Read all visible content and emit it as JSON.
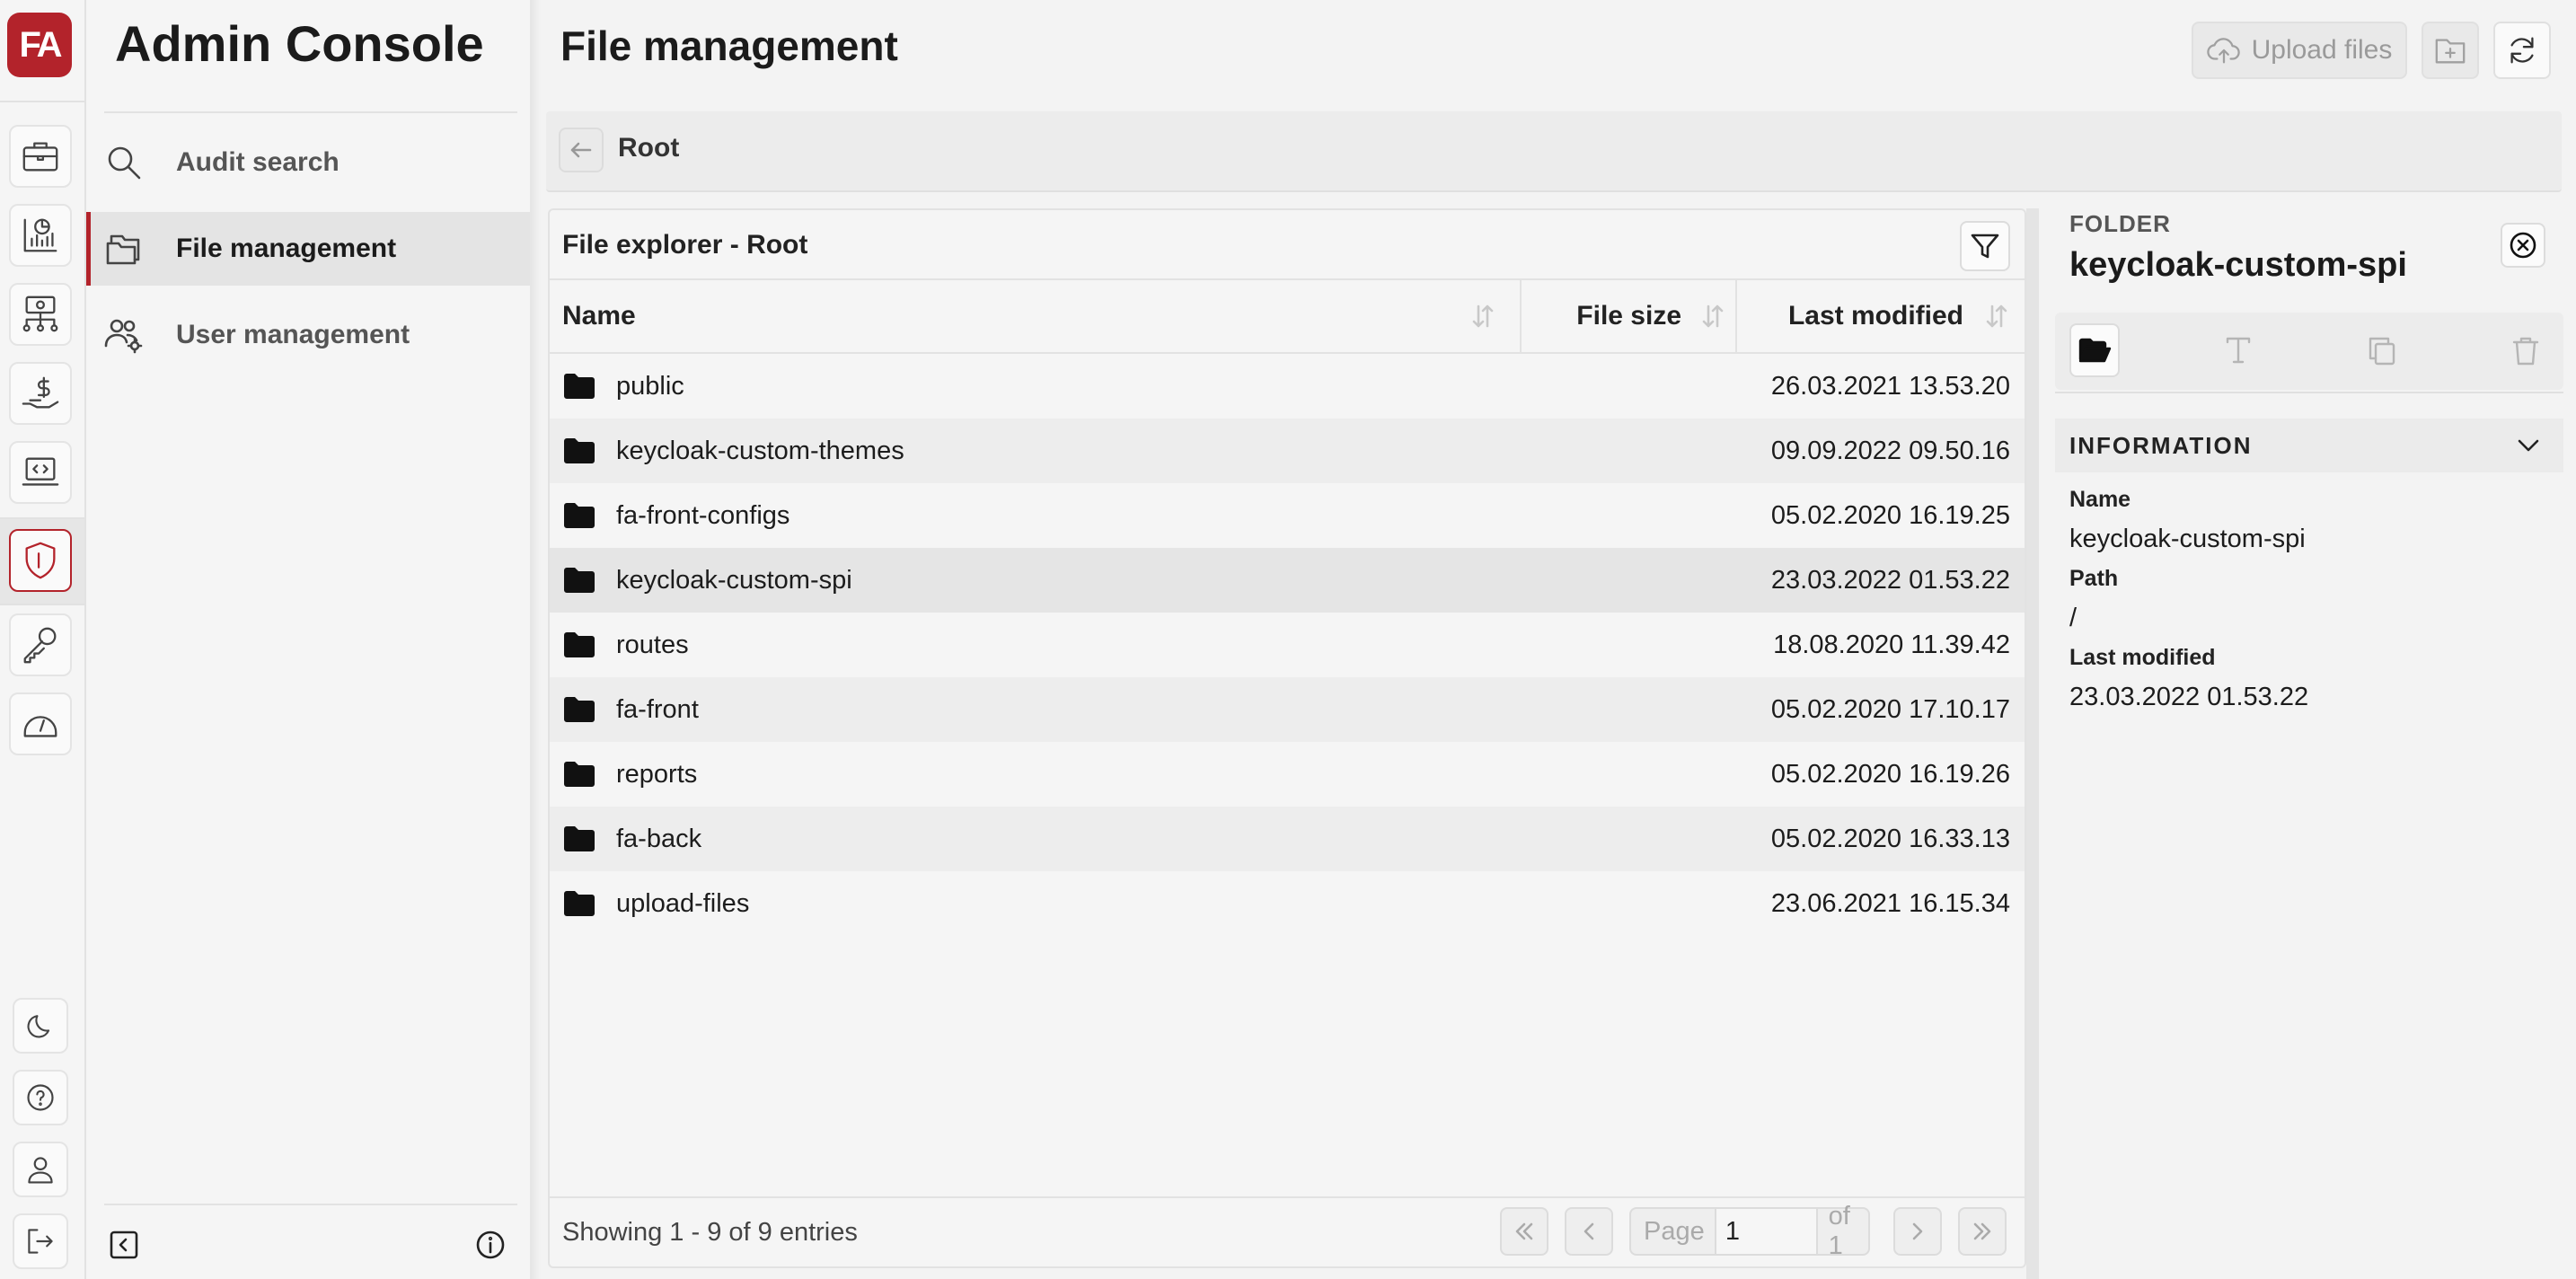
{
  "app": {
    "logo_text": "FA",
    "title": "Admin Console",
    "accent_color": "#b3232b"
  },
  "rail": {
    "items": [
      {
        "icon": "briefcase-icon"
      },
      {
        "icon": "reports-chart-icon"
      },
      {
        "icon": "network-money-icon"
      },
      {
        "icon": "hand-dollar-icon"
      },
      {
        "icon": "laptop-code-icon"
      },
      {
        "icon": "shield-icon",
        "active": true
      },
      {
        "icon": "key-icon"
      },
      {
        "icon": "gauge-icon"
      }
    ],
    "bottom": [
      {
        "icon": "moon-icon"
      },
      {
        "icon": "help-icon"
      },
      {
        "icon": "user-icon"
      },
      {
        "icon": "logout-icon"
      }
    ]
  },
  "sidebar": {
    "items": [
      {
        "label": "Audit search",
        "icon": "search-icon"
      },
      {
        "label": "File management",
        "icon": "folders-icon",
        "active": true
      },
      {
        "label": "User management",
        "icon": "users-gear-icon"
      }
    ]
  },
  "page": {
    "title": "File management",
    "toolbar": {
      "upload_label": "Upload files",
      "upload_enabled": false,
      "new_folder_enabled": false,
      "refresh_enabled": true
    }
  },
  "breadcrumb": {
    "current": "Root"
  },
  "explorer": {
    "title": "File explorer - Root",
    "columns": {
      "name": "Name",
      "size": "File size",
      "modified": "Last modified"
    },
    "rows": [
      {
        "name": "public",
        "size": "",
        "modified": "26.03.2021 13.53.20"
      },
      {
        "name": "keycloak-custom-themes",
        "size": "",
        "modified": "09.09.2022 09.50.16"
      },
      {
        "name": "fa-front-configs",
        "size": "",
        "modified": "05.02.2020 16.19.25"
      },
      {
        "name": "keycloak-custom-spi",
        "size": "",
        "modified": "23.03.2022 01.53.22",
        "selected": true
      },
      {
        "name": "routes",
        "size": "",
        "modified": "18.08.2020 11.39.42"
      },
      {
        "name": "fa-front",
        "size": "",
        "modified": "05.02.2020 17.10.17"
      },
      {
        "name": "reports",
        "size": "",
        "modified": "05.02.2020 16.19.26"
      },
      {
        "name": "fa-back",
        "size": "",
        "modified": "05.02.2020 16.33.13"
      },
      {
        "name": "upload-files",
        "size": "",
        "modified": "23.06.2021 16.15.34"
      }
    ],
    "footer": {
      "showing": "Showing 1 - 9 of 9 entries",
      "page_label": "Page",
      "page_value": "1",
      "of_label": "of 1"
    }
  },
  "details": {
    "type_label": "FOLDER",
    "name": "keycloak-custom-spi",
    "section_title": "INFORMATION",
    "fields": [
      {
        "label": "Name",
        "value": "keycloak-custom-spi"
      },
      {
        "label": "Path",
        "value": "/"
      },
      {
        "label": "Last modified",
        "value": "23.03.2022 01.53.22"
      }
    ]
  }
}
